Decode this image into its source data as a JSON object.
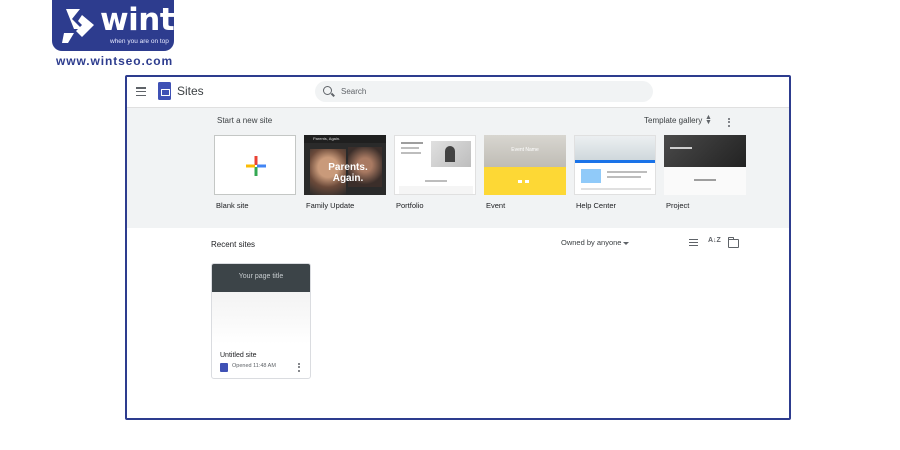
{
  "brand": {
    "wordmark": "wint",
    "tagline": "when you are on top",
    "url": "www.wintseo.com",
    "color": "#2d3c8e"
  },
  "app": {
    "title": "Sites",
    "menu_icon": "hamburger-menu-icon",
    "logo_icon": "google-sites-icon"
  },
  "search": {
    "placeholder": "Search",
    "icon": "search-icon"
  },
  "templates": {
    "start_label": "Start a new site",
    "gallery_label": "Template gallery",
    "items": [
      {
        "name": "Blank site",
        "icon": "plus-icon"
      },
      {
        "name": "Family Update",
        "hero_text": "Parents. Again.",
        "header_text": "Parents, Again."
      },
      {
        "name": "Portfolio"
      },
      {
        "name": "Event",
        "hero_text": "Event Name"
      },
      {
        "name": "Help Center"
      },
      {
        "name": "Project"
      }
    ]
  },
  "recent": {
    "title": "Recent sites",
    "owner_filter": "Owned by anyone",
    "sites": [
      {
        "name": "Untitled site",
        "preview_title": "Your page title",
        "opened": "Opened 11:48 AM"
      }
    ]
  },
  "colors": {
    "sites_blue": "#3f51b5",
    "template_band": "#f1f3f4",
    "event_yellow": "#fdd835",
    "help_blue": "#1a73e8"
  }
}
